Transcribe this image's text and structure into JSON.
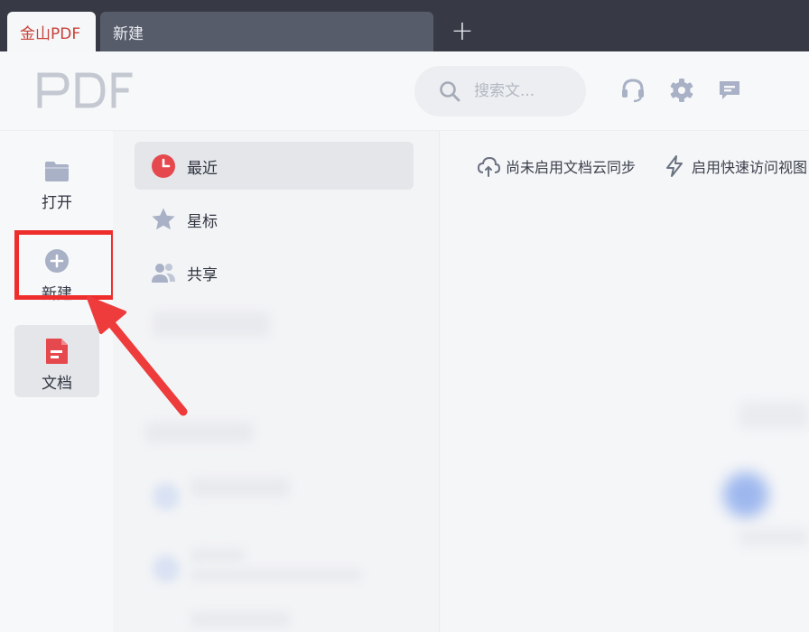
{
  "tabs": [
    {
      "label": "金山PDF",
      "active": true
    },
    {
      "label": "新建",
      "active": false
    }
  ],
  "tab_add_label": "+",
  "header": {
    "logo_icon": "pdf-logo-icon",
    "search_placeholder": "搜索文...",
    "icons": [
      "headset-icon",
      "gear-icon",
      "chat-icon"
    ]
  },
  "rail": {
    "items": [
      {
        "label": "打开",
        "icon": "folder-icon"
      },
      {
        "label": "新建",
        "icon": "plus-circle-icon"
      },
      {
        "label": "文档",
        "icon": "document-icon"
      }
    ]
  },
  "nav": {
    "items": [
      {
        "label": "最近",
        "icon": "clock-icon"
      },
      {
        "label": "星标",
        "icon": "star-icon"
      },
      {
        "label": "共享",
        "icon": "people-icon"
      }
    ]
  },
  "main": {
    "actions": [
      {
        "label": "尚未启用文档云同步",
        "icon": "cloud-sync-icon"
      },
      {
        "label": "启用快速访问视图",
        "icon": "lightning-icon"
      }
    ]
  },
  "colors": {
    "tabbar": "#373a45",
    "active_tab_text": "#c8413a",
    "highlight": "#ee2d2d",
    "recent_icon": "#e5484d",
    "doc_icon": "#e5484d",
    "muted_icon": "#a9b1c6"
  }
}
